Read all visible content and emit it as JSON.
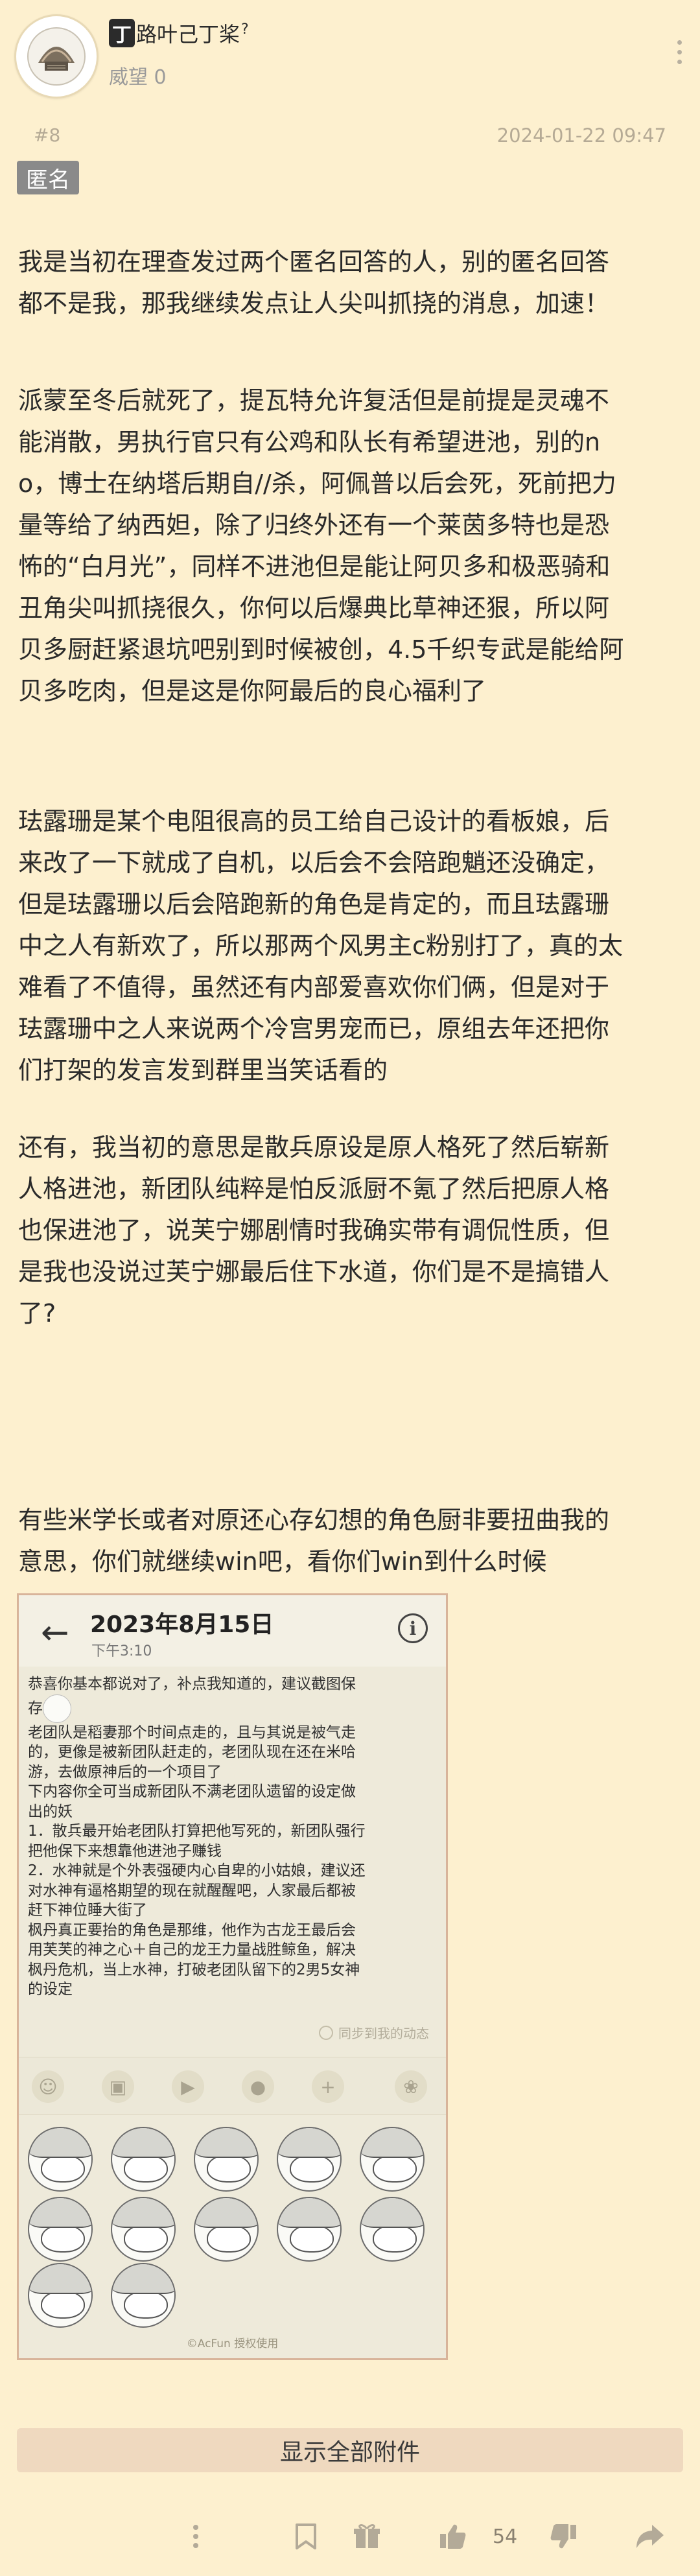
{
  "user": {
    "badge": "丁",
    "name": "路叶己丁桨",
    "name_suffix": "?",
    "reputation": "威望 0"
  },
  "post": {
    "floor": "#8",
    "datetime": "2024-01-22 09:47",
    "anon_tag": "匿名",
    "paragraphs": [
      "我是当初在理查发过两个匿名回答的人，别的匿名回答\n都不是我，那我继续发点让人尖叫抓挠的消息，加速！",
      "派蒙至冬后就死了，提瓦特允许复活但是前提是灵魂不\n能消散，男执行官只有公鸡和队长有希望进池，别的n\no，博士在纳塔后期自//杀，阿佩普以后会死，死前把力\n量等给了纳西妲，除了归终外还有一个莱茵多特也是恐\n怖的“白月光”，同样不进池但是能让阿贝多和极恶骑和\n丑角尖叫抓挠很久，你何以后爆典比草神还狠，所以阿\n贝多厨赶紧退坑吧别到时候被创，4.5千织专武是能给阿\n贝多吃肉，但是这是你阿最后的良心福利了",
      "珐露珊是某个电阻很高的员工给自己设计的看板娘，后\n来改了一下就成了自机，以后会不会陪跑魈还没确定，\n但是珐露珊以后会陪跑新的角色是肯定的，而且珐露珊\n中之人有新欢了，所以那两个风男主c粉别打了，真的太\n难看了不值得，虽然还有内部爱喜欢你们俩，但是对于\n珐露珊中之人来说两个冷宫男宠而已，原组去年还把你\n们打架的发言发到群里当笑话看的",
      "还有，我当初的意思是散兵原设是原人格死了然后崭新\n人格进池，新团队纯粹是怕反派厨不氪了然后把原人格\n也保进池了，说芙宁娜剧情时我确实带有调侃性质，但\n是我也没说过芙宁娜最后住下水道，你们是不是搞错人\n了?",
      "有些米学长或者对原还心存幻想的角色厨非要扭曲我的\n意思，你们就继续win吧，看你们win到什么时候"
    ]
  },
  "attachment": {
    "date": "2023年8月15日",
    "time": "下午3:10",
    "text_line1": "恭喜你基本都说对了，补点我知道的，建议截图保",
    "text_line2_prefix": "存",
    "text_rest": "老团队是稻妻那个时间点走的，且与其说是被气走\n的，更像是被新团队赶走的，老团队现在还在米哈\n游，去做原神后的一个项目了\n下内容你全可当成新团队不满老团队遗留的设定做\n出的妖\n1．散兵最开始老团队打算把他写死的，新团队强行\n把他保下来想靠他进池子赚钱\n2．水神就是个外表强硬内心自卑的小姑娘，建议还\n对水神有逼格期望的现在就醒醒吧，人家最后都被\n赶下神位睡大街了\n枫丹真正要抬的角色是那维，他作为古龙王最后会\n用芙芙的神之心＋自己的龙王力量战胜鲸鱼，解决\n枫丹危机，当上水神，打破老团队留下的2男5女神\n的设定",
    "sync_label": "同步到我的动态",
    "watermark": "©AcFun 授权使用"
  },
  "show_all_label": "显示全部附件",
  "actions": {
    "like_count": "54"
  },
  "colors": {
    "background": "#fdf0cf",
    "tag_gray": "#8a8a8a",
    "show_all_bg": "#efd9bf",
    "attachment_border": "#d8b49a"
  }
}
